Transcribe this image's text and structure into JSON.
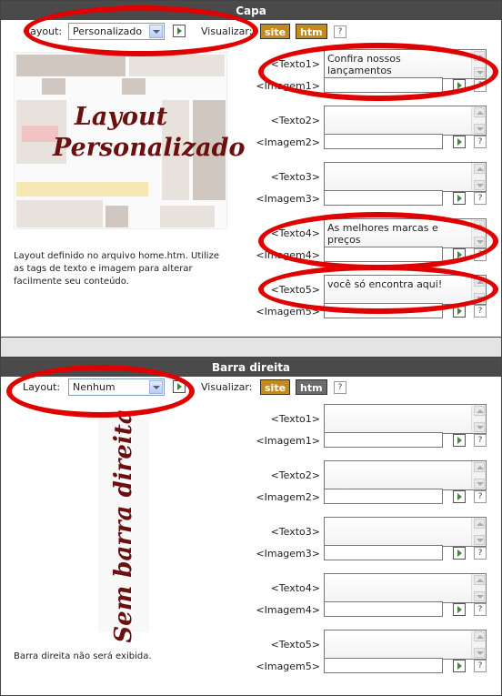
{
  "capa": {
    "title": "Capa",
    "layout_label": "Layout:",
    "layout_value": "Personalizado",
    "preview_label": "Visualizar:",
    "site_label": "site",
    "htm_label": "htm",
    "help_label": "?",
    "overlay_text_1": "Layout",
    "overlay_text_2": "Personalizado",
    "description": "Layout definido no arquivo home.htm. Utilize as tags de texto e imagem para alterar facilmente seu conteúdo.",
    "fields": [
      {
        "label": "<Texto1>",
        "value": "Confira nossos lançamentos"
      },
      {
        "label": "<Imagem1>"
      },
      {
        "label": "<Texto2>",
        "value": ""
      },
      {
        "label": "<Imagem2>"
      },
      {
        "label": "<Texto3>",
        "value": ""
      },
      {
        "label": "<Imagem3>"
      },
      {
        "label": "<Texto4>",
        "value": "As melhores marcas e preços"
      },
      {
        "label": "<Imagem4>"
      },
      {
        "label": "<Texto5>",
        "value": "você só encontra aqui!"
      },
      {
        "label": "<Imagem5>"
      }
    ]
  },
  "barra": {
    "title": "Barra direita",
    "layout_label": "Layout:",
    "layout_value": "Nenhum",
    "preview_label": "Visualizar:",
    "site_label": "site",
    "htm_label": "htm",
    "help_label": "?",
    "overlay_text": "Sem barra direita",
    "description": "Barra direita não será exibida.",
    "fields": [
      {
        "label": "<Texto1>",
        "value": ""
      },
      {
        "label": "<Imagem1>"
      },
      {
        "label": "<Texto2>",
        "value": ""
      },
      {
        "label": "<Imagem2>"
      },
      {
        "label": "<Texto3>",
        "value": ""
      },
      {
        "label": "<Imagem3>"
      },
      {
        "label": "<Texto4>",
        "value": ""
      },
      {
        "label": "<Imagem4>"
      },
      {
        "label": "<Texto5>",
        "value": ""
      },
      {
        "label": "<Imagem5>"
      }
    ]
  },
  "colors": {
    "header": "#4a4a4a",
    "annotation_red": "#e00000",
    "overlay_text": "#6b0f0f"
  }
}
